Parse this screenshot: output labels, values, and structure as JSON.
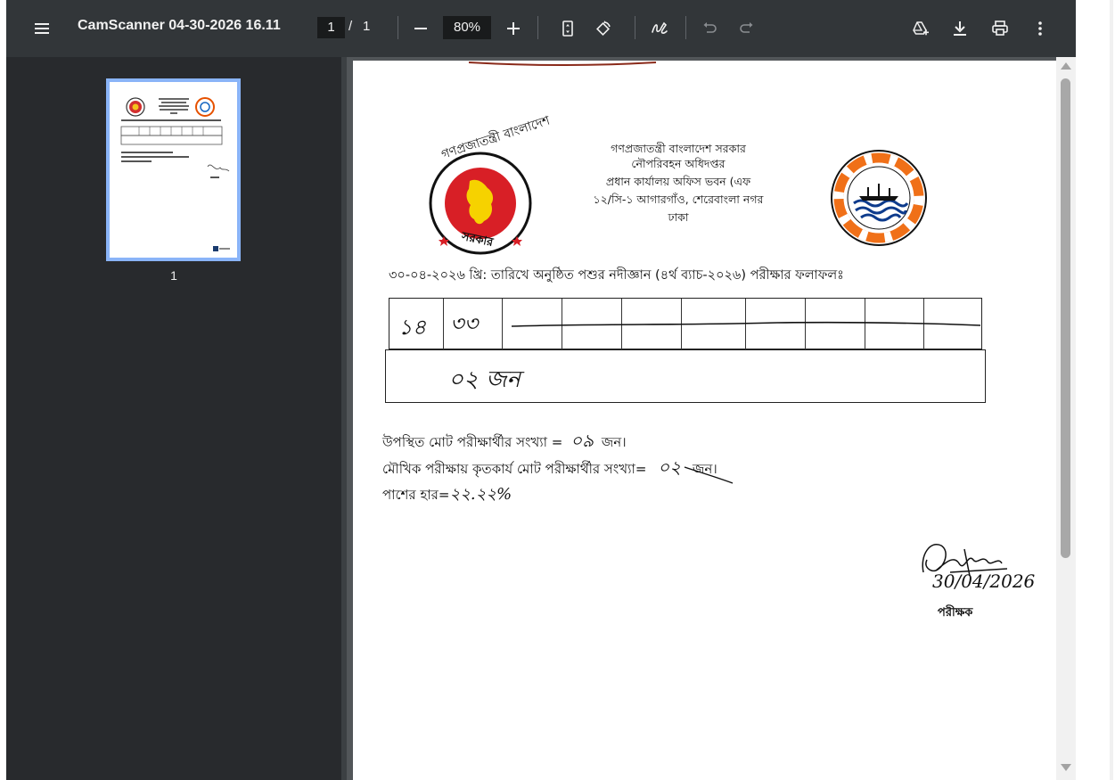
{
  "toolbar": {
    "title": "CamScanner 04-30-2026 16.11",
    "current_page": "1",
    "page_separator": "/",
    "total_pages": "1",
    "zoom": "80%"
  },
  "sidebar": {
    "thumbnail_label": "1"
  },
  "document": {
    "header_lines": [
      "গণপ্রজাতন্ত্রী বাংলাদেশ সরকার",
      "নৌপরিবহন অধিদপ্তর",
      "প্রধান কার্যালয় অফিস ভবন (এফ",
      "১২/সি-১ আগারগাঁও, শেরেবাংলা নগর",
      "ঢাকা"
    ],
    "left_seal_top_text": "গণপ্রজাতন্ত্রী বাংলাদেশ",
    "left_seal_bottom_text": "সরকার",
    "subject_line": "৩০-০৪-২০২৬ খ্রি: তারিখে অনুষ্ঠিত পশুর নদীজ্ঞান (৪র্থ ব্যাচ-২০২৬) পরীক্ষার ফলাফলঃ",
    "table_cell_1": "১৪",
    "table_cell_2": "৩৩",
    "table_row2": "০২ জন",
    "line_present": "উপস্থিত মোট পরীক্ষার্থীর সংখ্যা =",
    "line_present_value": "০৯",
    "line_present_unit": "জন।",
    "line_passed": "মৌখিক পরীক্ষায় কৃতকার্য মোট পরীক্ষার্থীর সংখ্যা=",
    "line_passed_value": "০২",
    "line_passed_unit": "জন।",
    "line_rate_label": "পাশের হার=",
    "line_rate_value": "২২.২২%",
    "signature_date": "30/04/2026",
    "examiner": "পরীক্ষক"
  },
  "colors": {
    "toolbar_bg": "#323639",
    "sidebar_bg": "#282a2d",
    "main_bg": "#525659",
    "thumb_border": "#8ab4f8"
  }
}
